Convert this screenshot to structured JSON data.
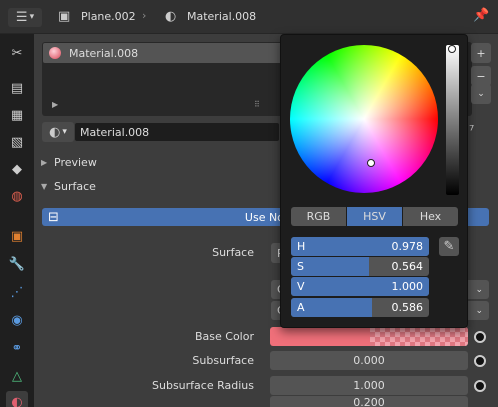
{
  "header": {
    "object_name": "Plane.002",
    "material_name": "Material.008"
  },
  "slots": {
    "items": [
      "Material.008"
    ]
  },
  "material_selector": {
    "name": "Material.008"
  },
  "panels": {
    "preview": "Preview",
    "surface": "Surface"
  },
  "use_nodes_label": "Use No",
  "props": {
    "surface_label": "Surface",
    "surface_value": "P",
    "base_color_label": "Base Color",
    "base_color_hex": "#f0707a",
    "subsurface_label": "Subsurface",
    "subsurface_value": "0.000",
    "subsurface_radius_label": "Subsurface Radius",
    "subsurface_radius_value": "1.000",
    "radius_2_value": "0.200",
    "row_c1": "C",
    "row_c2": "C"
  },
  "color_picker": {
    "modes": [
      "RGB",
      "HSV",
      "Hex"
    ],
    "active_mode": "HSV",
    "sliders": [
      {
        "label": "H",
        "value": "0.978",
        "level": 1.0
      },
      {
        "label": "S",
        "value": "0.564",
        "level": 0.564
      },
      {
        "label": "V",
        "value": "1.000",
        "level": 1.0
      },
      {
        "label": "A",
        "value": "0.586",
        "level": 0.586
      }
    ]
  },
  "colors": {
    "accent": "#4772b3",
    "panel_bg": "#3d3d3d",
    "popup_bg": "#1d1d1d"
  }
}
